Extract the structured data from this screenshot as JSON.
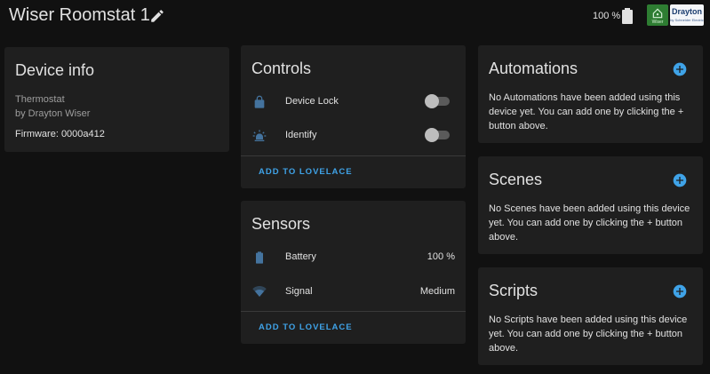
{
  "header": {
    "title": "Wiser Roomstat 1",
    "battery": "100 %",
    "logo_small_label": "Wiser",
    "logo_brand": "Drayton",
    "logo_sub": "by Schneider Electric"
  },
  "device_info": {
    "title": "Device info",
    "model": "Thermostat",
    "manufacturer": "by Drayton Wiser",
    "firmware": "Firmware: 0000a412"
  },
  "controls": {
    "title": "Controls",
    "items": [
      {
        "label": "Device Lock",
        "icon": "lock-icon",
        "state": "off"
      },
      {
        "label": "Identify",
        "icon": "alarm-light-icon",
        "state": "off"
      }
    ],
    "action": "ADD TO LOVELACE"
  },
  "sensors": {
    "title": "Sensors",
    "items": [
      {
        "label": "Battery",
        "icon": "battery-icon",
        "value": "100 %"
      },
      {
        "label": "Signal",
        "icon": "wifi-icon",
        "value": "Medium"
      }
    ],
    "action": "ADD TO LOVELACE"
  },
  "automations": {
    "title": "Automations",
    "desc": "No Automations have been added using this device yet. You can add one by clicking the + button above."
  },
  "scenes": {
    "title": "Scenes",
    "desc": "No Scenes have been added using this device yet. You can add one by clicking the + button above."
  },
  "scripts": {
    "title": "Scripts",
    "desc": "No Scripts have been added using this device yet. You can add one by clicking the + button above."
  },
  "colors": {
    "background": "#111111",
    "card": "#1f1f1f",
    "accent": "#3fa3e8",
    "icon": "#44739e"
  }
}
